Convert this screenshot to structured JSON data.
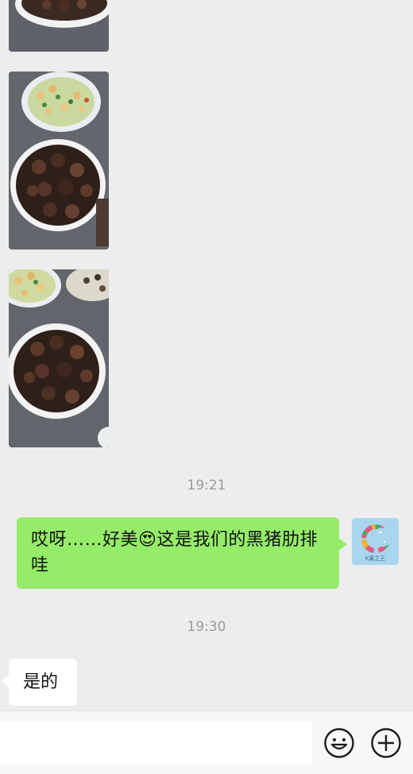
{
  "messages": {
    "timestamp_1": "19:21",
    "outgoing_text": "哎呀……好美",
    "outgoing_text_2": "这是我们的黑猪肋排哇",
    "emoji_glyph": "😍",
    "timestamp_2": "19:30",
    "incoming_text": "是的"
  },
  "avatar": {
    "caption": "K果之王"
  },
  "photos": [
    {
      "icon": "food-photo-icon",
      "description_hidden": true
    },
    {
      "icon": "food-photo-icon"
    },
    {
      "icon": "food-photo-icon"
    }
  ],
  "input_bar": {
    "placeholder": "",
    "emoji_button": "emoji-icon",
    "plus_button": "plus-icon"
  },
  "colors": {
    "outgoing_bubble": "#95ec69",
    "incoming_bubble": "#ffffff",
    "background": "#ededed"
  }
}
